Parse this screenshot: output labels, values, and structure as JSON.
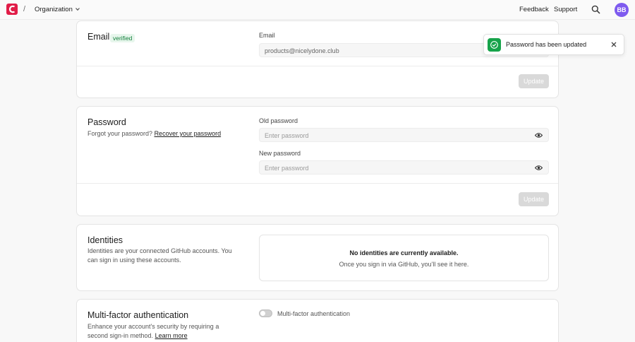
{
  "topbar": {
    "separator": "/",
    "org_label": "Organization",
    "feedback": "Feedback",
    "support": "Support",
    "avatar": "BB",
    "brand_color": "#e11d48",
    "avatar_color": "#7e5bef"
  },
  "email_section": {
    "title": "Email",
    "badge": "verified",
    "field_label": "Email",
    "field_value": "products@nicelydone.club",
    "button": "Update"
  },
  "password_section": {
    "title": "Password",
    "desc_prefix": "Forgot your password?",
    "desc_link": "Recover your password",
    "old_label": "Old password",
    "old_placeholder": "Enter password",
    "new_label": "New password",
    "new_placeholder": "Enter password",
    "button": "Update"
  },
  "identities_section": {
    "title": "Identities",
    "desc": "Identities are your connected GitHub accounts. You can sign in using these accounts.",
    "empty_title": "No identities are currently available.",
    "empty_desc": "Once you sign in via GitHub, you'll see it here."
  },
  "mfa_section": {
    "title": "Multi-factor authentication",
    "desc": "Enhance your account's security by requiring a second sign-in method.",
    "desc_link": "Learn more",
    "toggle_label": "Multi-factor authentication",
    "toggle_on": false
  },
  "toast": {
    "message": "Password has been updated",
    "status_color": "#16a34a"
  },
  "icons": [
    "brand-logo-icon",
    "chevron-down-icon",
    "search-icon",
    "eye-icon",
    "check-icon",
    "close-icon"
  ]
}
